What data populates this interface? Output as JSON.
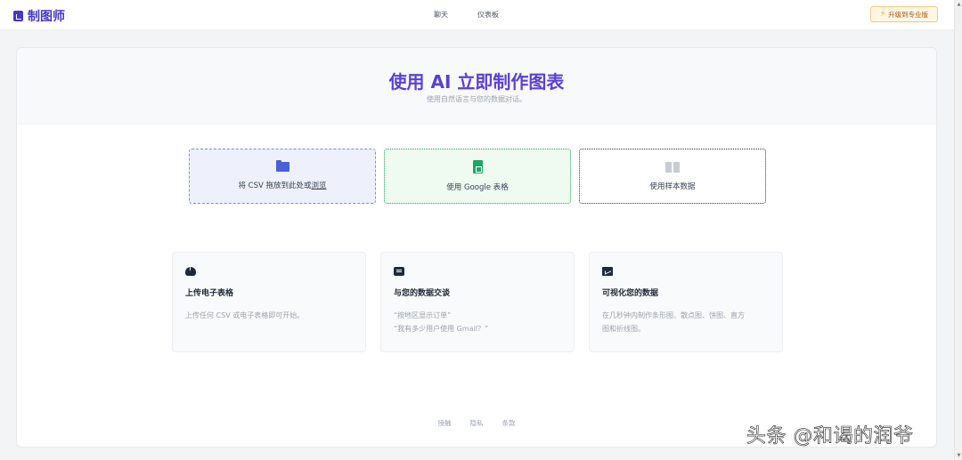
{
  "brand": {
    "name": "制图师"
  },
  "nav": {
    "chat": "聊天",
    "dashboard": "仪表板"
  },
  "upgrade": {
    "label": "升级到专业版"
  },
  "hero": {
    "title": "使用 AI 立即制作图表",
    "subtitle": "使用自然语言与您的数据对话。"
  },
  "options": {
    "csv": {
      "prefix": "将 CSV 拖放到此处或",
      "link": "浏览"
    },
    "google": {
      "label": "使用 Google 表格"
    },
    "sample": {
      "label": "使用样本数据"
    }
  },
  "features": [
    {
      "title": "上传电子表格",
      "lines": [
        "上传任何 CSV 或电子表格即可开始。"
      ]
    },
    {
      "title": "与您的数据交谈",
      "lines": [
        "“按地区显示订单”",
        "“我有多少用户使用 Gmail？”"
      ]
    },
    {
      "title": "可视化您的数据",
      "lines": [
        "在几秒钟内制作条形图、散点图、饼图、直方",
        "图和折线图。"
      ]
    }
  ],
  "footer": {
    "contact": "接触",
    "privacy": "隐私",
    "terms": "条款"
  },
  "watermark": "头条 @和谒的润爷",
  "colors": {
    "accent": "#5b3fd6",
    "brand": "#4338ca",
    "google_green": "#1fa463",
    "upgrade_orange": "#f59e0b"
  },
  "icons": {
    "brand": "chart-logo-icon",
    "upgrade": "bolt-icon",
    "csv": "folder-icon",
    "google": "sheet-icon",
    "sample": "book-icon",
    "features": [
      "cloud-upload-icon",
      "chat-bubble-icon",
      "chart-icon"
    ]
  }
}
